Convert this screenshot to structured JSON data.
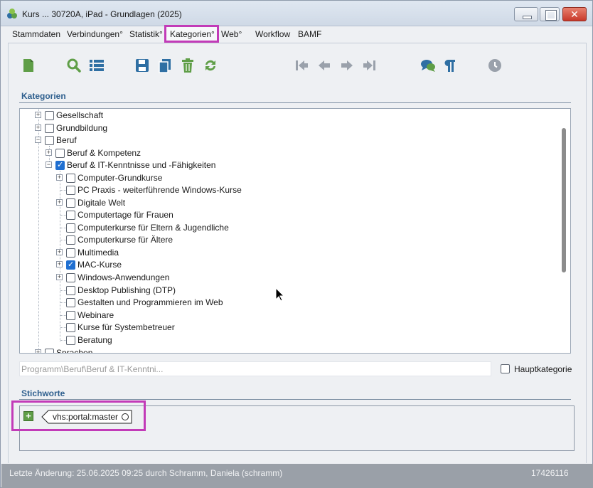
{
  "window": {
    "title": "Kurs ... 30720A, iPad - Grundlagen (2025)",
    "close_glyph": "✕"
  },
  "tabs": [
    {
      "label": "Stammdaten"
    },
    {
      "label": "Verbindungen°"
    },
    {
      "label": "Statistik°"
    },
    {
      "label": "Kategorien°",
      "selected": true
    },
    {
      "label": "Web°"
    },
    {
      "label": "Workflow"
    },
    {
      "label": "BAMF"
    }
  ],
  "toolbar": {
    "icons": [
      "new-document-icon",
      "search-icon",
      "list-icon",
      "save-icon",
      "copy-icon",
      "delete-icon",
      "refresh-icon",
      "first-icon",
      "previous-icon",
      "next-icon",
      "last-icon",
      "comments-icon",
      "paragraph-icon",
      "history-clock-icon"
    ]
  },
  "kategorien": {
    "title": "Kategorien",
    "tree": [
      {
        "label": "Gesellschaft",
        "level": 0,
        "expander": "+",
        "checked": false
      },
      {
        "label": "Grundbildung",
        "level": 0,
        "expander": "+",
        "checked": false
      },
      {
        "label": "Beruf",
        "level": 0,
        "expander": "-",
        "checked": false
      },
      {
        "label": "Beruf & Kompetenz",
        "level": 1,
        "expander": "+",
        "checked": false
      },
      {
        "label": "Beruf & IT-Kenntnisse und -Fähigkeiten",
        "level": 1,
        "expander": "-",
        "checked": true
      },
      {
        "label": "Computer-Grundkurse",
        "level": 2,
        "expander": "+",
        "checked": false
      },
      {
        "label": "PC Praxis - weiterführende Windows-Kurse",
        "level": 2,
        "expander": "",
        "checked": false
      },
      {
        "label": "Digitale Welt",
        "level": 2,
        "expander": "+",
        "checked": false
      },
      {
        "label": "Computertage für Frauen",
        "level": 2,
        "expander": "",
        "checked": false
      },
      {
        "label": "Computerkurse für Eltern & Jugendliche",
        "level": 2,
        "expander": "",
        "checked": false
      },
      {
        "label": "Computerkurse für Ältere",
        "level": 2,
        "expander": "",
        "checked": false
      },
      {
        "label": "Multimedia",
        "level": 2,
        "expander": "+",
        "checked": false
      },
      {
        "label": "MAC-Kurse",
        "level": 2,
        "expander": "+",
        "checked": true
      },
      {
        "label": "Windows-Anwendungen",
        "level": 2,
        "expander": "+",
        "checked": false
      },
      {
        "label": "Desktop Publishing (DTP)",
        "level": 2,
        "expander": "",
        "checked": false
      },
      {
        "label": "Gestalten und Programmieren im Web",
        "level": 2,
        "expander": "",
        "checked": false
      },
      {
        "label": "Webinare",
        "level": 2,
        "expander": "",
        "checked": false
      },
      {
        "label": "Kurse für Systembetreuer",
        "level": 2,
        "expander": "",
        "checked": false
      },
      {
        "label": "Beratung",
        "level": 2,
        "expander": "",
        "checked": false
      },
      {
        "label": "Sprachen",
        "level": 0,
        "expander": "+",
        "checked": false
      }
    ],
    "path_value": "Programm\\Beruf\\Beruf & IT-Kenntni...",
    "hauptkategorie_label": "Hauptkategorie",
    "hauptkategorie_checked": false
  },
  "stichworte": {
    "title": "Stichworte",
    "add_glyph": "+",
    "tags": [
      "vhs:portal:master"
    ]
  },
  "status": {
    "last_change": "Letzte Änderung: 25.06.2025 09:25 durch Schramm, Daniela (schramm)",
    "record_id": "17426116"
  },
  "colors": {
    "accent": "#2e5f8e",
    "highlight": "#c23bb8",
    "toolbar_green": "#5f9e47",
    "toolbar_blue": "#2f6fa3"
  }
}
